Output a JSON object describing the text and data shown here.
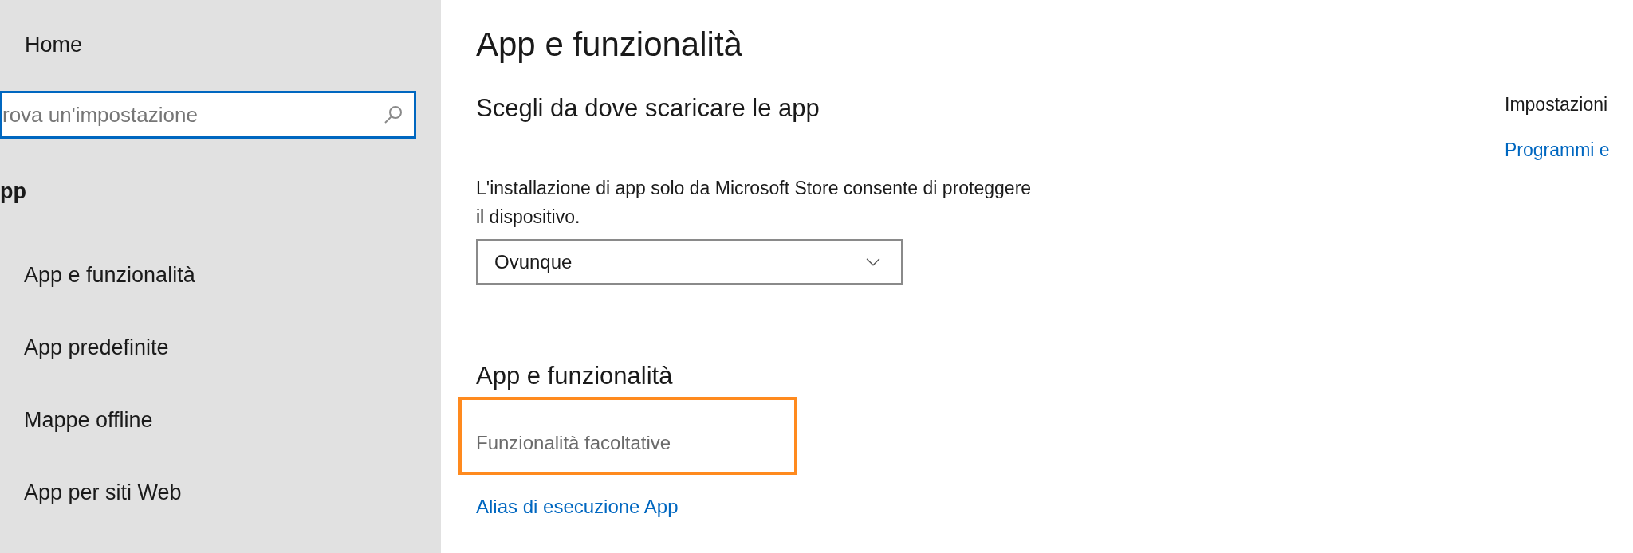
{
  "sidebar": {
    "home": "Home",
    "search": {
      "placeholder": "rova un'impostazione"
    },
    "section_title": "pp",
    "items": [
      {
        "label": "App e funzionalità",
        "selected": false
      },
      {
        "label": "App predefinite",
        "selected": false
      },
      {
        "label": "Mappe offline",
        "selected": false
      },
      {
        "label": "App per siti Web",
        "selected": false
      }
    ]
  },
  "main": {
    "title": "App e funzionalità",
    "install_section": {
      "heading": "Scegli da dove scaricare le app",
      "description": "L'installazione di app solo da Microsoft Store consente di proteggere il dispositivo.",
      "dropdown": {
        "value": "Ovunque"
      }
    },
    "features_section": {
      "heading": "App e funzionalità",
      "links": [
        {
          "label": "Funzionalità facoltative",
          "kind": "muted",
          "highlighted": true
        },
        {
          "label": "Alias di esecuzione App",
          "kind": "link",
          "highlighted": false
        }
      ]
    }
  },
  "related": {
    "heading": "Impostazioni",
    "link": "Programmi e"
  }
}
